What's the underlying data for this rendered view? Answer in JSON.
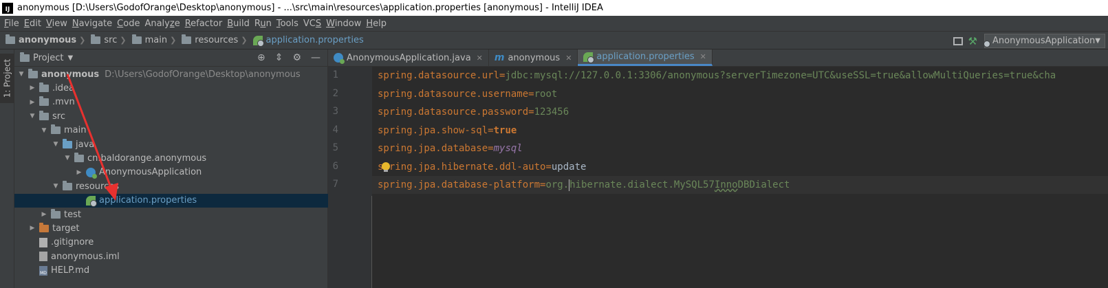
{
  "window": {
    "title": "anonymous [D:\\Users\\GodofOrange\\Desktop\\anonymous] - ...\\src\\main\\resources\\application.properties [anonymous] - IntelliJ IDEA",
    "logo": "IJ"
  },
  "menu": [
    {
      "mnemonic": "F",
      "rest": "ile"
    },
    {
      "mnemonic": "E",
      "rest": "dit"
    },
    {
      "mnemonic": "V",
      "rest": "iew"
    },
    {
      "mnemonic": "N",
      "rest": "avigate"
    },
    {
      "mnemonic": "C",
      "rest": "ode"
    },
    {
      "pre": "Analy",
      "mnemonic": "z",
      "rest": "e"
    },
    {
      "mnemonic": "R",
      "rest": "efactor"
    },
    {
      "mnemonic": "B",
      "rest": "uild"
    },
    {
      "pre": "R",
      "mnemonic": "u",
      "rest": "n"
    },
    {
      "mnemonic": "T",
      "rest": "ools"
    },
    {
      "pre": "VC",
      "mnemonic": "S",
      "rest": ""
    },
    {
      "mnemonic": "W",
      "rest": "indow"
    },
    {
      "mnemonic": "H",
      "rest": "elp"
    }
  ],
  "breadcrumbs": [
    "anonymous",
    "src",
    "main",
    "resources",
    "application.properties"
  ],
  "run_config": {
    "label": "AnonymousApplication"
  },
  "left_stripe": {
    "label": "1: Project"
  },
  "project_panel": {
    "title": "Project",
    "tree": [
      {
        "label": "anonymous",
        "path": "D:\\Users\\GodofOrange\\Desktop\\anonymous"
      },
      {
        "label": ".idea"
      },
      {
        "label": ".mvn"
      },
      {
        "label": "src"
      },
      {
        "label": "main"
      },
      {
        "label": "java"
      },
      {
        "label": "cn.baldorange.anonymous"
      },
      {
        "label": "AnonymousApplication"
      },
      {
        "label": "resources"
      },
      {
        "label": "application.properties"
      },
      {
        "label": "test"
      },
      {
        "label": "target"
      },
      {
        "label": ".gitignore"
      },
      {
        "label": "anonymous.iml"
      },
      {
        "label": "HELP.md"
      }
    ]
  },
  "editor_tabs": [
    {
      "label": "AnonymousApplication.java",
      "active": false
    },
    {
      "label": "anonymous",
      "active": false
    },
    {
      "label": "application.properties",
      "active": true
    }
  ],
  "editor": {
    "line_numbers": [
      "1",
      "2",
      "3",
      "4",
      "5",
      "6",
      "7"
    ],
    "lines": [
      {
        "key": "spring.datasource.url",
        "eq": "=",
        "value": "jdbc:mysql://127.0.0.1:3306/anonymous?serverTimezone=UTC&useSSL=true&allowMultiQueries=true&cha"
      },
      {
        "key": "spring.datasource.username",
        "eq": "=",
        "value": "root"
      },
      {
        "key": "spring.datasource.password",
        "eq": "=",
        "value": "123456"
      },
      {
        "key": "spring.jpa.show-sql",
        "eq": "=",
        "value": "true"
      },
      {
        "key": "spring.jpa.database",
        "eq": "=",
        "value": "mysql"
      },
      {
        "key": "spring.jpa.hibernate.ddl-auto",
        "eq": "=",
        "value": "update"
      },
      {
        "key": "spring.jpa.database-platform",
        "eq": "=",
        "value_a": "org.",
        "value_b": "hibernate.dialect.MySQL57",
        "value_c": "Inno",
        "value_d": "DBDialect"
      }
    ]
  },
  "colors": {
    "accent": "#4a88c7",
    "selection": "#0d293e",
    "annotation_arrow": "#e8312f"
  }
}
